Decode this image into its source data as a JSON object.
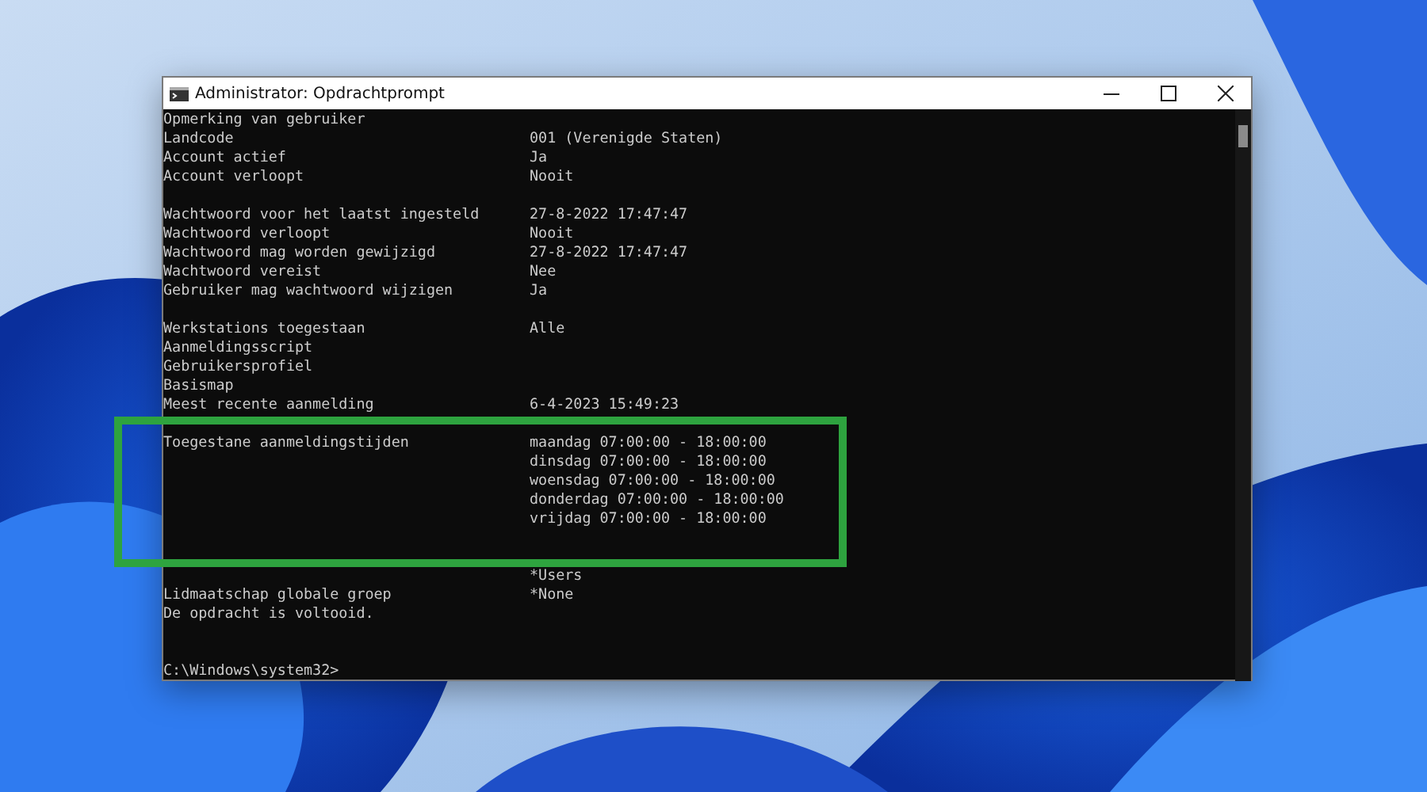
{
  "window": {
    "title": "Administrator: Opdrachtprompt"
  },
  "console": {
    "lines": [
      {
        "kind": "line",
        "label": "Opmerking van gebruiker"
      },
      {
        "kind": "line",
        "label": "Landcode",
        "values": [
          "001 (Verenigde Staten)"
        ]
      },
      {
        "kind": "line",
        "label": "Account actief",
        "values": [
          "Ja"
        ]
      },
      {
        "kind": "line",
        "label": "Account verloopt",
        "values": [
          "Nooit"
        ]
      },
      {
        "kind": "blank"
      },
      {
        "kind": "line",
        "label": "Wachtwoord voor het laatst ingesteld",
        "values": [
          "27-8-2022 17:47:47"
        ]
      },
      {
        "kind": "line",
        "label": "Wachtwoord verloopt",
        "values": [
          "Nooit"
        ]
      },
      {
        "kind": "line",
        "label": "Wachtwoord mag worden gewijzigd",
        "values": [
          "27-8-2022 17:47:47"
        ]
      },
      {
        "kind": "line",
        "label": "Wachtwoord vereist",
        "values": [
          "Nee"
        ]
      },
      {
        "kind": "line",
        "label": "Gebruiker mag wachtwoord wijzigen",
        "values": [
          "Ja"
        ]
      },
      {
        "kind": "blank"
      },
      {
        "kind": "line",
        "label": "Werkstations toegestaan",
        "values": [
          "Alle"
        ]
      },
      {
        "kind": "line",
        "label": "Aanmeldingsscript"
      },
      {
        "kind": "line",
        "label": "Gebruikersprofiel"
      },
      {
        "kind": "line",
        "label": "Basismap"
      },
      {
        "kind": "line",
        "label": "Meest recente aanmelding",
        "values": [
          "6-4-2023 15:49:23"
        ]
      },
      {
        "kind": "blank"
      },
      {
        "kind": "line",
        "label": "Toegestane aanmeldingstijden",
        "values": [
          "maandag 07:00:00 - 18:00:00",
          "dinsdag 07:00:00 - 18:00:00",
          "woensdag 07:00:00 - 18:00:00",
          "donderdag 07:00:00 - 18:00:00",
          "vrijdag 07:00:00 - 18:00:00"
        ]
      },
      {
        "kind": "blank"
      },
      {
        "kind": "blank"
      },
      {
        "kind": "line",
        "values": [
          "*Users"
        ]
      },
      {
        "kind": "line",
        "label": "Lidmaatschap globale groep",
        "values": [
          "*None"
        ]
      },
      {
        "kind": "line",
        "label": "De opdracht is voltooid."
      },
      {
        "kind": "blank"
      },
      {
        "kind": "blank"
      },
      {
        "kind": "prompt",
        "label": "C:\\Windows\\system32>"
      }
    ]
  }
}
